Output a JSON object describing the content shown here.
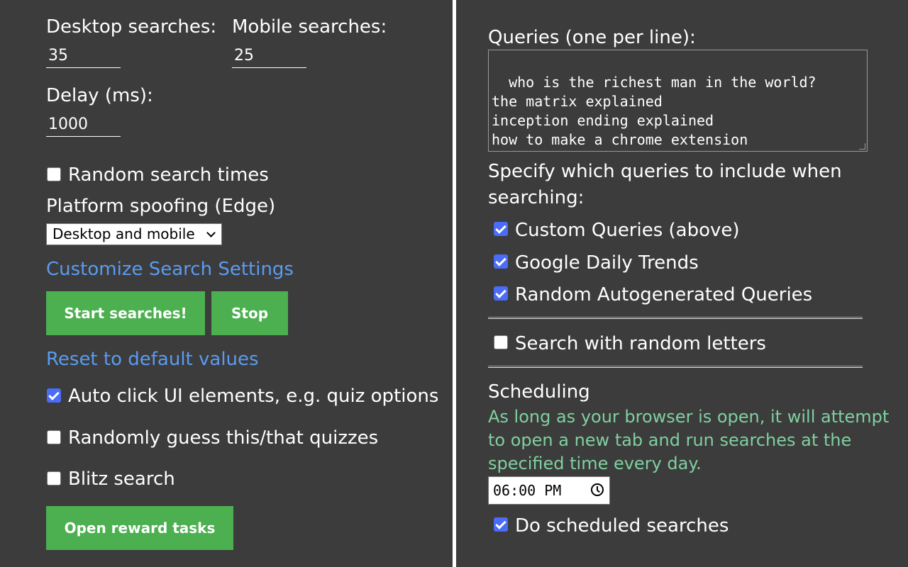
{
  "left": {
    "desktop_searches_label": "Desktop searches:",
    "desktop_searches_value": "35",
    "mobile_searches_label": "Mobile searches:",
    "mobile_searches_value": "25",
    "delay_label": "Delay (ms):",
    "delay_value": "1000",
    "random_times_label": "Random search times",
    "random_times_checked": false,
    "platform_label": "Platform spoofing (Edge)",
    "platform_selected": "Desktop and mobile",
    "customize_link": "Customize Search Settings",
    "start_button": "Start searches!",
    "stop_button": "Stop",
    "reset_link": "Reset to default values",
    "auto_click_label": "Auto click UI elements, e.g. quiz options",
    "auto_click_checked": true,
    "random_guess_label": "Randomly guess this/that quizzes",
    "random_guess_checked": false,
    "blitz_label": "Blitz search",
    "blitz_checked": false,
    "open_rewards_button": "Open reward tasks"
  },
  "right": {
    "queries_label": "Queries (one per line):",
    "queries_text": "who is the richest man in the world?\nthe matrix explained\ninception ending explained\nhow to make a chrome extension",
    "include_label_line1": "Specify which queries to include when",
    "include_label_line2": "searching:",
    "custom_queries_label": "Custom Queries (above)",
    "custom_queries_checked": true,
    "google_trends_label": "Google Daily Trends",
    "google_trends_checked": true,
    "random_auto_label": "Random Autogenerated Queries",
    "random_auto_checked": true,
    "random_letters_label": "Search with random letters",
    "random_letters_checked": false,
    "scheduling_heading": "Scheduling",
    "scheduling_desc_line1": "As long as your browser is open, it will attempt",
    "scheduling_desc_line2": "to open a new tab and run searches at the",
    "scheduling_desc_line3": "specified time every day.",
    "schedule_time": "06:00 PM",
    "do_scheduled_label": "Do scheduled searches",
    "do_scheduled_checked": true
  },
  "colors": {
    "background": "#3c3c3c",
    "button_green": "#4caf50",
    "link_blue": "#5a9bf0",
    "checkbox_blue": "#4a6cf7",
    "scheduling_text": "#7fd0a0"
  }
}
